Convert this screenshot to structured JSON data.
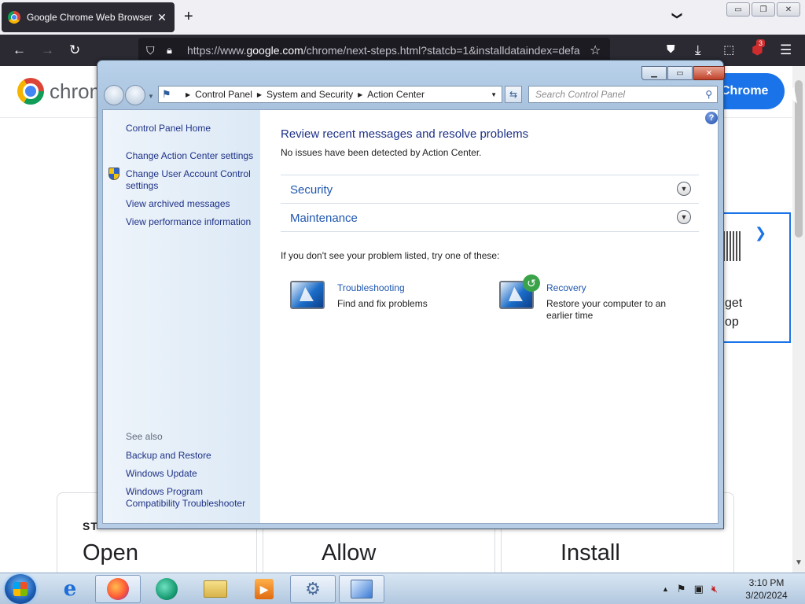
{
  "browser": {
    "tab_title": "Google Chrome Web Browser",
    "tab_close": "✕",
    "new_tab": "+",
    "tab_list": "❯",
    "url_prefix": "https://www.",
    "url_domain": "google.com",
    "url_rest": "/chrome/next-steps.html?statcb=1&installdataindex=defa",
    "extension_badge": "3",
    "window_minimize": "▭",
    "window_restore": "❐",
    "window_close": "✕"
  },
  "webpage": {
    "logo_text": "chrom",
    "cta_button": "Chrome",
    "qr_text_line1": "get",
    "qr_text_line2": "op",
    "step_label": "ST",
    "step_cards": [
      "Open",
      "Allow",
      "Install"
    ]
  },
  "control_panel": {
    "breadcrumb": [
      "Control Panel",
      "System and Security",
      "Action Center"
    ],
    "search_placeholder": "Search Control Panel",
    "sidebar": {
      "home": "Control Panel Home",
      "links": [
        "Change Action Center settings",
        "Change User Account Control settings",
        "View archived messages",
        "View performance information"
      ],
      "see_also_label": "See also",
      "see_also_links": [
        "Backup and Restore",
        "Windows Update",
        "Windows Program Compatibility Troubleshooter"
      ]
    },
    "main": {
      "title": "Review recent messages and resolve problems",
      "subtitle": "No issues have been detected by Action Center.",
      "sections": [
        "Security",
        "Maintenance"
      ],
      "try_text": "If you don't see your problem listed, try one of these:",
      "tools": [
        {
          "title": "Troubleshooting",
          "description": "Find and fix problems"
        },
        {
          "title": "Recovery",
          "description": "Restore your computer to an earlier time"
        }
      ]
    }
  },
  "taskbar": {
    "time": "3:10 PM",
    "date": "3/20/2024"
  }
}
